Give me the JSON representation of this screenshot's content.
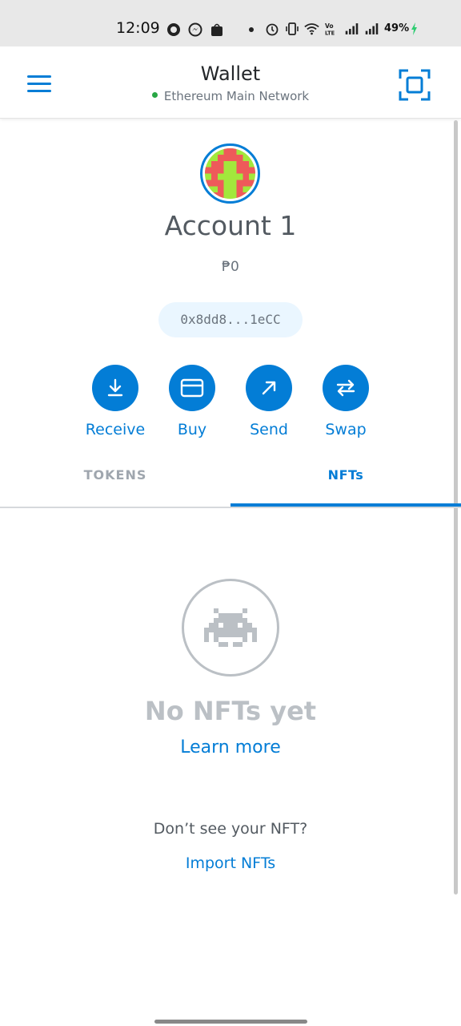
{
  "status_bar": {
    "time": "12:09",
    "battery": "49%",
    "icons": [
      "whatsapp-icon",
      "messenger-icon",
      "shopee-icon",
      "dot-icon",
      "alarm-icon",
      "vibrate-icon",
      "wifi-icon",
      "volte-icon",
      "signal-icon",
      "signal-icon",
      "charging-icon"
    ]
  },
  "header": {
    "title": "Wallet",
    "network": "Ethereum Main Network",
    "network_status_color": "#28a745",
    "menu_icon": "hamburger-icon",
    "scan_icon": "qr-scan-icon"
  },
  "account": {
    "name": "Account 1",
    "balance": "₱0",
    "address": "0x8dd8...1eCC"
  },
  "actions": [
    {
      "label": "Receive",
      "icon": "download-arrow-icon"
    },
    {
      "label": "Buy",
      "icon": "card-icon"
    },
    {
      "label": "Send",
      "icon": "arrow-up-right-icon"
    },
    {
      "label": "Swap",
      "icon": "swap-arrows-icon"
    }
  ],
  "tabs": [
    {
      "label": "TOKENS",
      "active": false
    },
    {
      "label": "NFTs",
      "active": true
    }
  ],
  "nft_empty": {
    "icon": "space-invader-icon",
    "title": "No NFTs yet",
    "learn_more": "Learn more",
    "prompt": "Don’t see your NFT?",
    "import_link": "Import NFTs"
  },
  "colors": {
    "accent": "#037dd6",
    "muted": "#bbc0c5",
    "address_bg": "#eaf6ff"
  }
}
